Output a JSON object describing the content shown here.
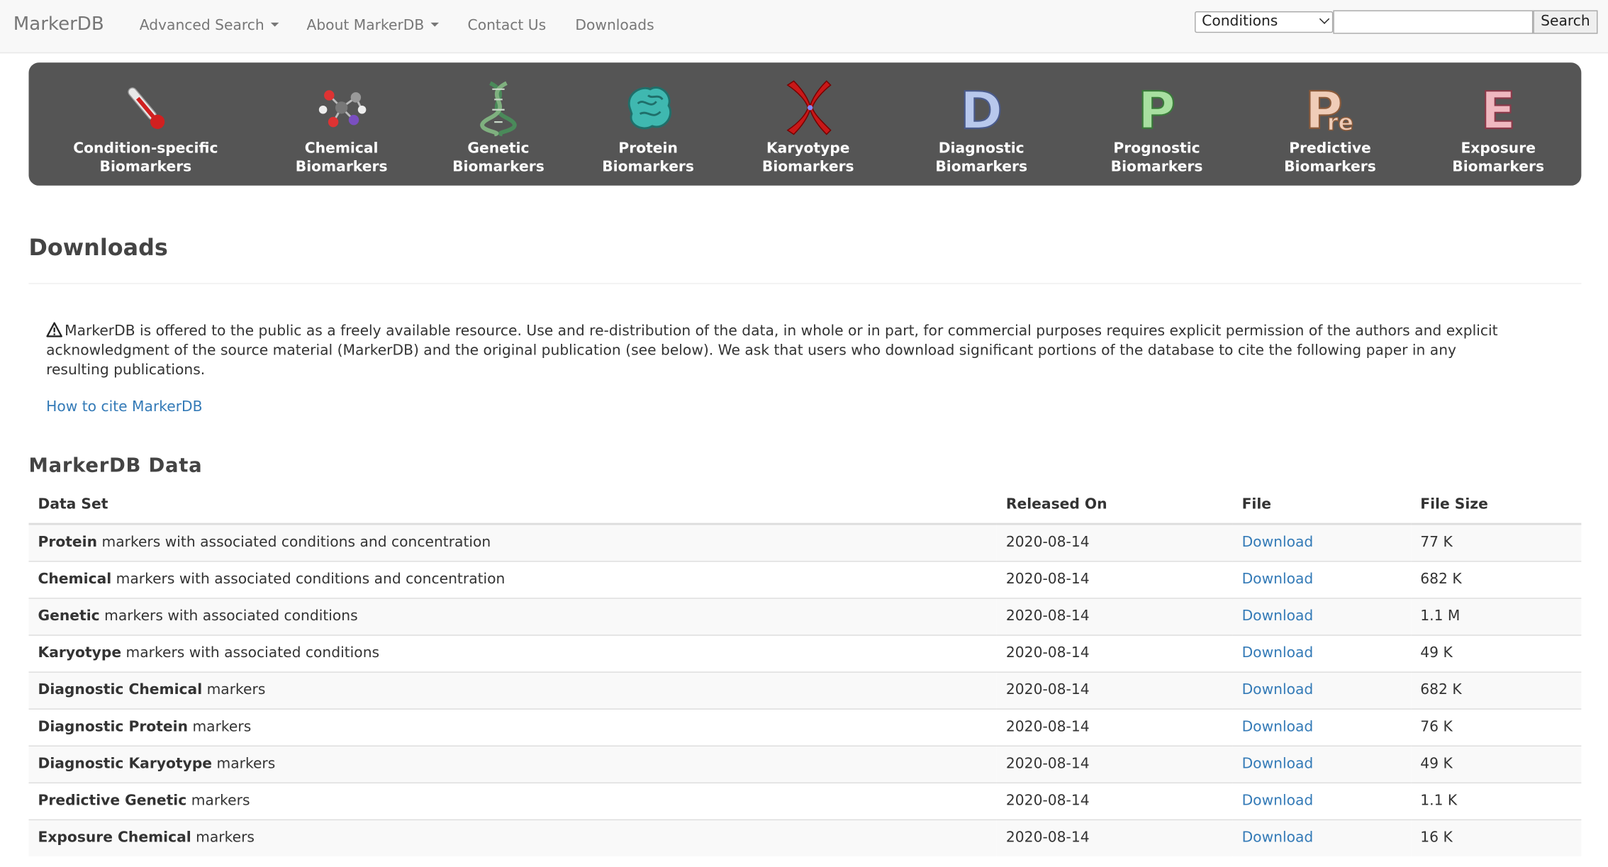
{
  "nav": {
    "brand": "MarkerDB",
    "advanced_search": "Advanced Search",
    "about": "About MarkerDB",
    "contact": "Contact Us",
    "downloads": "Downloads"
  },
  "search": {
    "selected": "Conditions",
    "button": "Search"
  },
  "categories": [
    {
      "line1": "Condition-specific",
      "line2": "Biomarkers",
      "icon": "thermometer-icon"
    },
    {
      "line1": "Chemical",
      "line2": "Biomarkers",
      "icon": "molecule-icon"
    },
    {
      "line1": "Genetic",
      "line2": "Biomarkers",
      "icon": "dna-icon"
    },
    {
      "line1": "Protein",
      "line2": "Biomarkers",
      "icon": "protein-icon"
    },
    {
      "line1": "Karyotype",
      "line2": "Biomarkers",
      "icon": "chromosome-icon"
    },
    {
      "line1": "Diagnostic",
      "line2": "Biomarkers",
      "icon": "letter-d-icon"
    },
    {
      "line1": "Prognostic",
      "line2": "Biomarkers",
      "icon": "letter-p-icon"
    },
    {
      "line1": "Predictive",
      "line2": "Biomarkers",
      "icon": "letter-pre-icon"
    },
    {
      "line1": "Exposure",
      "line2": "Biomarkers",
      "icon": "letter-e-icon"
    }
  ],
  "colors": {
    "banner_bg": "#555555",
    "link": "#337ab7"
  },
  "page": {
    "title": "Downloads",
    "notice": "MarkerDB is offered to the public as a freely available resource. Use and re-distribution of the data, in whole or in part, for commercial purposes requires explicit permission of the authors and explicit acknowledgment of the source material (MarkerDB) and the original publication (see below). We ask that users who download significant portions of the database to cite the following paper in any resulting publications.",
    "cite_link": "How to cite MarkerDB",
    "section_title": "MarkerDB Data"
  },
  "table": {
    "headers": [
      "Data Set",
      "Released On",
      "File",
      "File Size"
    ],
    "rows": [
      {
        "bold": "Protein",
        "rest": " markers with associated conditions and concentration",
        "released": "2020-08-14",
        "file": "Download",
        "size": "77 K"
      },
      {
        "bold": "Chemical",
        "rest": " markers with associated conditions and concentration",
        "released": "2020-08-14",
        "file": "Download",
        "size": "682 K"
      },
      {
        "bold": "Genetic",
        "rest": " markers with associated conditions",
        "released": "2020-08-14",
        "file": "Download",
        "size": "1.1 M"
      },
      {
        "bold": "Karyotype",
        "rest": " markers with associated conditions",
        "released": "2020-08-14",
        "file": "Download",
        "size": "49 K"
      },
      {
        "bold": "Diagnostic Chemical",
        "rest": " markers",
        "released": "2020-08-14",
        "file": "Download",
        "size": "682 K"
      },
      {
        "bold": "Diagnostic Protein",
        "rest": " markers",
        "released": "2020-08-14",
        "file": "Download",
        "size": "76 K"
      },
      {
        "bold": "Diagnostic Karyotype",
        "rest": " markers",
        "released": "2020-08-14",
        "file": "Download",
        "size": "49 K"
      },
      {
        "bold": "Predictive Genetic",
        "rest": " markers",
        "released": "2020-08-14",
        "file": "Download",
        "size": "1.1 K"
      },
      {
        "bold": "Exposure Chemical",
        "rest": " markers",
        "released": "2020-08-14",
        "file": "Download",
        "size": "16 K"
      }
    ]
  }
}
